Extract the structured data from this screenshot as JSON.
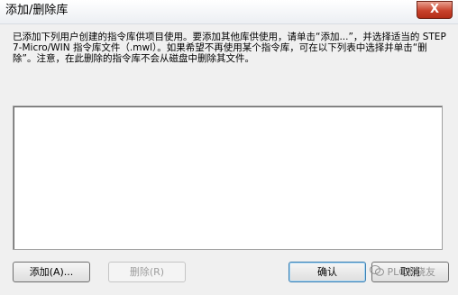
{
  "window": {
    "title": "添加/删除库",
    "close_label": "X"
  },
  "description": "已添加下列用户创建的指令库供项目使用。要添加其他库供使用，请单击“添加...”，并选择适当的 STEP 7-Micro/WIN 指令库文件（.mwl）。如果希望不再使用某个指令库，可在以下列表中选择并单击“删除”。注意，在此删除的指令库不会从磁盘中删除其文件。",
  "library_list": {
    "items": []
  },
  "buttons": {
    "add_label": "添加(A)...",
    "delete_label": "删除(R)",
    "ok_label": "确认",
    "cancel_label": "取消"
  },
  "watermark": {
    "text": "PLC发烧友"
  },
  "colors": {
    "close_button": "#c8422c",
    "dialog_background": "#f0f0f0",
    "disabled_text": "#9e9e9e"
  }
}
